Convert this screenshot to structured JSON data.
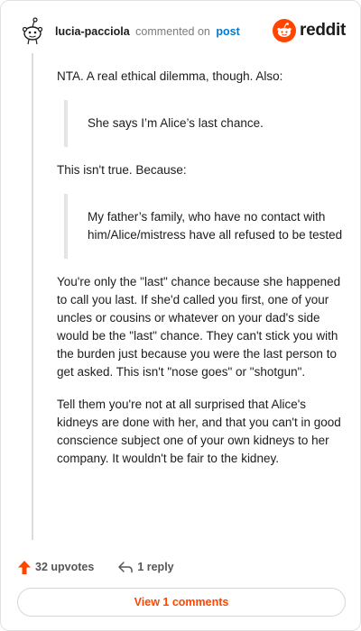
{
  "comment": {
    "author": "lucia-pacciola",
    "action": "commented on",
    "target": "post",
    "brand": "reddit",
    "paragraphs": {
      "p1": "NTA. A real ethical dilemma, though. Also:",
      "quote1": "She says I’m Alice’s last chance.",
      "p2": "This isn't true. Because:",
      "quote2": "My father’s family, who have no contact with him/Alice/mistress have all refused to be tested",
      "p3": "You're only the \"last\" chance because she happened to call you last. If she'd called you first, one of your uncles or cousins or whatever on your dad's side would be the \"last\" chance. They can't stick you with the burden just because you were the last person to get asked. This isn't \"nose goes\" or \"shotgun\".",
      "p4": "Tell them you're not at all surprised that Alice's kidneys are done with her, and that you can't in good conscience subject one of your own kidneys to her company. It wouldn't be fair to the kidney."
    }
  },
  "footer": {
    "upvotes": "32 upvotes",
    "replies": "1 reply",
    "view_comments": "View 1 comments"
  },
  "colors": {
    "accent": "#ff4500",
    "link": "#0079d3",
    "muted": "#7c7c7c"
  },
  "icons": {
    "avatar": "snoo-avatar-icon",
    "brand": "reddit-logo-icon",
    "upvote": "upvote-arrow-icon",
    "reply": "reply-arrow-icon"
  }
}
